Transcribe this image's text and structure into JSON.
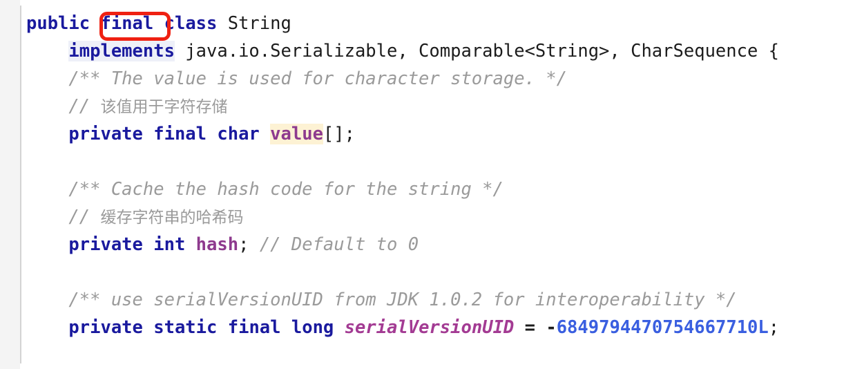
{
  "editor": {
    "language": "java",
    "background_color": "#ffffff",
    "gutter_color": "#f4f4f4",
    "gutter_rule_color": "#d3d3d3"
  },
  "annotation": {
    "type": "rectangle-highlight",
    "target_token": "final",
    "color": "#ef2112",
    "shape": "rounded-rectangle"
  },
  "colors": {
    "keyword": "#1a1a9e",
    "identifier": "#8e3a8e",
    "number": "#3a5fe0",
    "comment": "#9a9a9a",
    "plain": "#1c1c1c",
    "identifier_highlight_bg": "#fdf2d4",
    "keyword_highlight_bg": "#eef0f8"
  },
  "code": {
    "lines": [
      {
        "n": 1,
        "text": "public final class String",
        "tokens": [
          {
            "t": "public",
            "k": "kw"
          },
          {
            "t": " ",
            "k": "plain"
          },
          {
            "t": "final",
            "k": "kw",
            "annotated": true
          },
          {
            "t": " ",
            "k": "plain"
          },
          {
            "t": "class",
            "k": "kw"
          },
          {
            "t": " String",
            "k": "plain"
          }
        ]
      },
      {
        "n": 2,
        "text": "    implements java.io.Serializable, Comparable<String>, CharSequence {",
        "tokens": [
          {
            "t": "    ",
            "k": "plain"
          },
          {
            "t": "implements",
            "k": "kw-hl"
          },
          {
            "t": " java.io.Serializable, Comparable<String>, CharSequence {",
            "k": "plain"
          }
        ]
      },
      {
        "n": 3,
        "text": "    /** The value is used for character storage. */",
        "tokens": [
          {
            "t": "    ",
            "k": "plain"
          },
          {
            "t": "/** The value is used for character storage. */",
            "k": "comment"
          }
        ]
      },
      {
        "n": 4,
        "text": "    // 该值用于字符存储",
        "tokens": [
          {
            "t": "    ",
            "k": "plain"
          },
          {
            "t": "// ",
            "k": "comment"
          },
          {
            "t": "该值用于字符存储",
            "k": "comment-cjk"
          }
        ]
      },
      {
        "n": 5,
        "text": "    private final char value[];",
        "tokens": [
          {
            "t": "    ",
            "k": "plain"
          },
          {
            "t": "private",
            "k": "kw"
          },
          {
            "t": " ",
            "k": "plain"
          },
          {
            "t": "final",
            "k": "kw"
          },
          {
            "t": " ",
            "k": "plain"
          },
          {
            "t": "char",
            "k": "kw"
          },
          {
            "t": " ",
            "k": "plain"
          },
          {
            "t": "value",
            "k": "ident-hl"
          },
          {
            "t": "[];",
            "k": "plain"
          }
        ]
      },
      {
        "n": 6,
        "text": "",
        "tokens": []
      },
      {
        "n": 7,
        "text": "    /** Cache the hash code for the string */",
        "tokens": [
          {
            "t": "    ",
            "k": "plain"
          },
          {
            "t": "/** Cache the hash code for the string */",
            "k": "comment"
          }
        ]
      },
      {
        "n": 8,
        "text": "    // 缓存字符串的哈希码",
        "tokens": [
          {
            "t": "    ",
            "k": "plain"
          },
          {
            "t": "// ",
            "k": "comment"
          },
          {
            "t": "缓存字符串的哈希码",
            "k": "comment-cjk"
          }
        ]
      },
      {
        "n": 9,
        "text": "    private int hash; // Default to 0",
        "tokens": [
          {
            "t": "    ",
            "k": "plain"
          },
          {
            "t": "private",
            "k": "kw"
          },
          {
            "t": " ",
            "k": "plain"
          },
          {
            "t": "int",
            "k": "kw"
          },
          {
            "t": " ",
            "k": "plain"
          },
          {
            "t": "hash",
            "k": "ident"
          },
          {
            "t": "; ",
            "k": "plain"
          },
          {
            "t": "// Default to 0",
            "k": "comment"
          }
        ]
      },
      {
        "n": 10,
        "text": "",
        "tokens": []
      },
      {
        "n": 11,
        "text": "    /** use serialVersionUID from JDK 1.0.2 for interoperability */",
        "tokens": [
          {
            "t": "    ",
            "k": "plain"
          },
          {
            "t": "/** use serialVersionUID from JDK 1.0.2 for interoperability */",
            "k": "comment"
          }
        ]
      },
      {
        "n": 12,
        "text": "    private static final long serialVersionUID = -6849794470754667710L;",
        "tokens": [
          {
            "t": "    ",
            "k": "plain"
          },
          {
            "t": "private",
            "k": "kw"
          },
          {
            "t": " ",
            "k": "plain"
          },
          {
            "t": "static",
            "k": "kw"
          },
          {
            "t": " ",
            "k": "plain"
          },
          {
            "t": "final",
            "k": "kw"
          },
          {
            "t": " ",
            "k": "plain"
          },
          {
            "t": "long",
            "k": "kw"
          },
          {
            "t": " ",
            "k": "plain"
          },
          {
            "t": "serialVersionUID",
            "k": "ident-it"
          },
          {
            "t": " = ",
            "k": "op"
          },
          {
            "t": "-",
            "k": "op"
          },
          {
            "t": "6849794470754667710L",
            "k": "num"
          },
          {
            "t": ";",
            "k": "plain"
          }
        ]
      }
    ]
  }
}
